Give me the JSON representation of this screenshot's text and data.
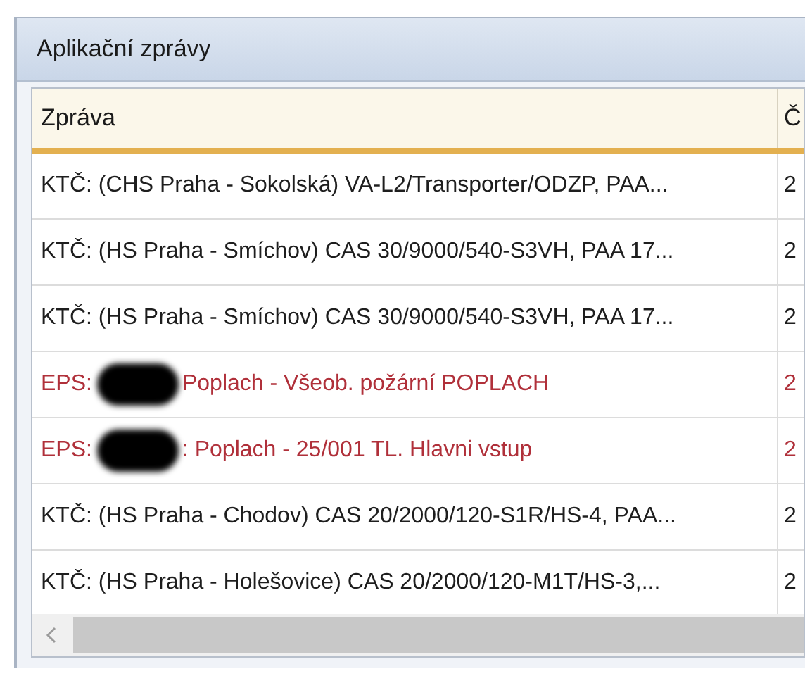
{
  "panel": {
    "title": "Aplikační zprávy"
  },
  "table": {
    "columns": [
      "Zpráva",
      "Č"
    ],
    "rows": [
      {
        "kind": "normal",
        "message": "KTČ: (CHS Praha - Sokolská) VA-L2/Transporter/ODZP, PAA...",
        "column_2": "2"
      },
      {
        "kind": "normal",
        "message": "KTČ: (HS Praha - Smíchov) CAS 30/9000/540-S3VH, PAA 17...",
        "column_2": "2"
      },
      {
        "kind": "normal",
        "message": "KTČ: (HS Praha - Smíchov) CAS 30/9000/540-S3VH, PAA 17...",
        "column_2": "2"
      },
      {
        "kind": "alarm",
        "prefix": "EPS:",
        "redacted": true,
        "message": "Poplach - Všeob. požární POPLACH",
        "column_2": "2"
      },
      {
        "kind": "alarm",
        "prefix": "EPS:",
        "redacted": true,
        "message": ": Poplach - 25/001 TL. Hlavni vstup",
        "column_2": "2"
      },
      {
        "kind": "normal",
        "message": "KTČ: (HS Praha - Chodov) CAS 20/2000/120-S1R/HS-4, PAA...",
        "column_2": "2"
      },
      {
        "kind": "normal",
        "message": "KTČ: (HS Praha - Holešovice) CAS 20/2000/120-M1T/HS-3,...",
        "column_2": "2"
      }
    ]
  }
}
